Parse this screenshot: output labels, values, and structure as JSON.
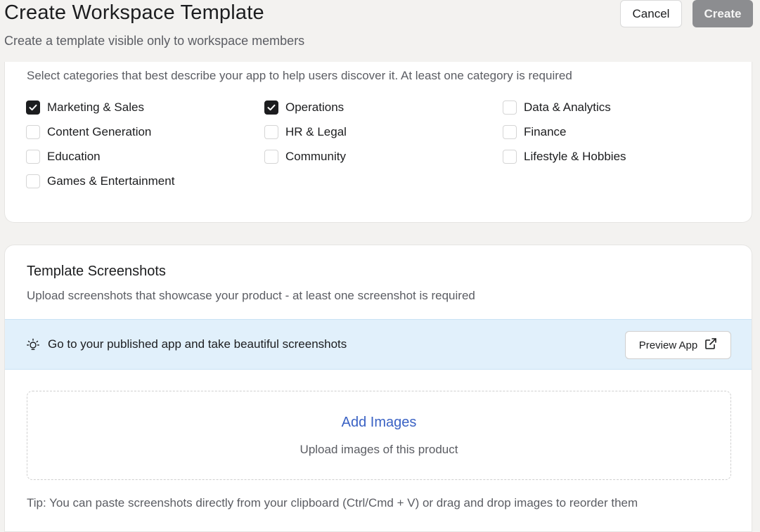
{
  "header": {
    "title": "Create Workspace Template",
    "subtitle": "Create a template visible only to workspace members",
    "cancel_label": "Cancel",
    "create_label": "Create"
  },
  "categories": {
    "description": "Select categories that best describe your app to help users discover it. At least one category is required",
    "items": [
      {
        "label": "Marketing & Sales",
        "checked": true
      },
      {
        "label": "Operations",
        "checked": true
      },
      {
        "label": "Data & Analytics",
        "checked": false
      },
      {
        "label": "Content Generation",
        "checked": false
      },
      {
        "label": "HR & Legal",
        "checked": false
      },
      {
        "label": "Finance",
        "checked": false
      },
      {
        "label": "Education",
        "checked": false
      },
      {
        "label": "Community",
        "checked": false
      },
      {
        "label": "Lifestyle & Hobbies",
        "checked": false
      },
      {
        "label": "Games & Entertainment",
        "checked": false
      }
    ]
  },
  "screenshots": {
    "title": "Template Screenshots",
    "description": "Upload screenshots that showcase your product - at least one screenshot is required",
    "banner_icon": "lightbulb-icon",
    "banner_text": "Go to your published app and take beautiful screenshots",
    "preview_label": "Preview App",
    "preview_icon": "external-link-icon",
    "add_images_label": "Add Images",
    "upload_hint": "Upload images of this product",
    "tip": "Tip: You can paste screenshots directly from your clipboard (Ctrl/Cmd + V) or drag and drop images to reorder them"
  },
  "colors": {
    "create_disabled": "#8c8d90",
    "banner_bg": "#e1f0fb",
    "link": "#3a62c4",
    "checkbox_checked": "#1c1d1f"
  }
}
